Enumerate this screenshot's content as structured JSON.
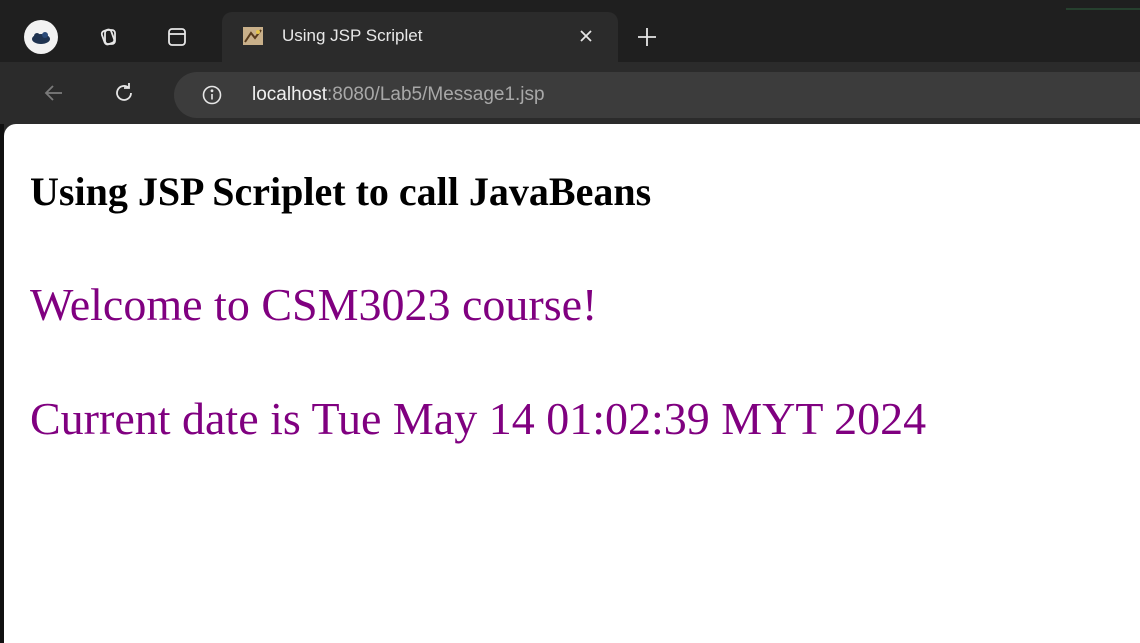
{
  "browser": {
    "tab": {
      "title": "Using JSP Scriplet",
      "favicon": "jsp-favicon"
    },
    "address_bar": {
      "host": "localhost",
      "path": ":8080/Lab5/Message1.jsp"
    },
    "icons": {
      "profile": "profile-avatar-icon",
      "workspaces": "workspaces-icon",
      "tab_actions": "vertical-tabs-icon",
      "close_tab": "close-icon",
      "new_tab": "plus-icon",
      "back": "back-arrow-icon",
      "reload": "reload-icon",
      "site_info": "info-icon"
    },
    "colors": {
      "titlebar": "#1f1f1f",
      "toolbar": "#2b2b2b",
      "omnibox": "#3c3c3c"
    }
  },
  "page": {
    "heading": "Using JSP Scriplet to call JavaBeans",
    "welcome_message": "Welcome to CSM3023 course!",
    "date_message": "Current date is Tue May 14 01:02:39 MYT 2024",
    "colors": {
      "heading": "#000000",
      "message": "#800080"
    }
  }
}
